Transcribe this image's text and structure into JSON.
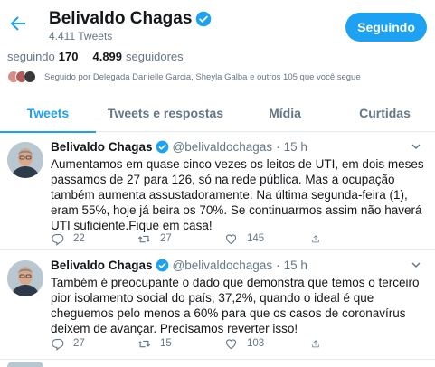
{
  "header": {
    "name": "Belivaldo Chagas",
    "tweet_count": "4.411 Tweets",
    "follow_label": "Seguindo"
  },
  "stats": {
    "following_label": "seguindo",
    "following_count": "170",
    "followers_count": "4.899",
    "followers_label": "seguidores"
  },
  "followed_by": "Seguido por Delegada Danielle Garcia, Sheyla Galba e outros 105 que você segue",
  "tabs": [
    {
      "label": "Tweets",
      "active": true
    },
    {
      "label": "Tweets e respostas",
      "active": false
    },
    {
      "label": "Mídia",
      "active": false
    },
    {
      "label": "Curtidas",
      "active": false
    }
  ],
  "tweets": [
    {
      "name": "Belivaldo Chagas",
      "handle": "@belivaldochagas",
      "dot": "·",
      "time": "15 h",
      "text": "Aumentamos em quase cinco vezes os leitos de UTI, em dois meses passamos de 27 para 126, só na rede pública. Mas a ocupação também aumenta assustadoramente. Na última segunda-feira (1), eram 55%, hoje já beira os 70%. Se continuarmos assim não haverá UTI suficiente.Fique em casa!",
      "replies": "22",
      "retweets": "27",
      "likes": "145"
    },
    {
      "name": "Belivaldo Chagas",
      "handle": "@belivaldochagas",
      "dot": "·",
      "time": "15 h",
      "text": "Também é preocupante o dado que demonstra que temos o terceiro pior isolamento social do país, 37,2%, quando o ideal é que cheguemos pelo menos a 60% para que os casos de coronavírus deixem de avançar. Precisamos reverter isso!",
      "replies": "27",
      "retweets": "15",
      "likes": "103"
    }
  ],
  "colors": {
    "accent": "#1da1f2",
    "muted": "#657786",
    "text": "#14171a",
    "border": "#e6ecf0"
  }
}
